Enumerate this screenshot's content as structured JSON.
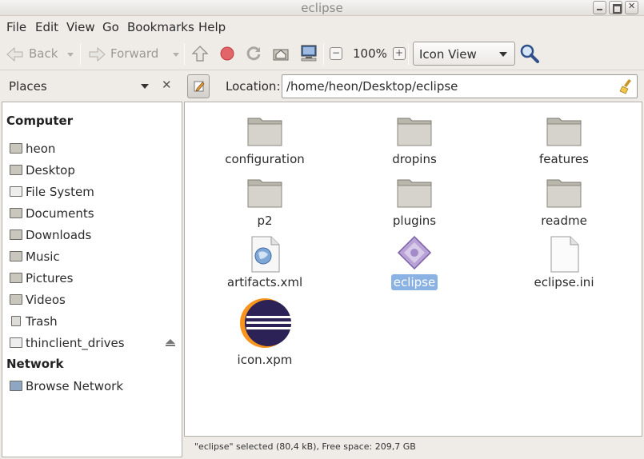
{
  "window": {
    "title": "eclipse"
  },
  "menu": [
    "File",
    "Edit",
    "View",
    "Go",
    "Bookmarks",
    "Help"
  ],
  "toolbar": {
    "back_label": "Back",
    "forward_label": "Forward",
    "zoom": "100%",
    "view_mode": "Icon View"
  },
  "sidebar": {
    "title": "Places",
    "sections": {
      "computer": "Computer",
      "network": "Network"
    },
    "places": [
      {
        "label": "heon",
        "icon": "home-folder-icon"
      },
      {
        "label": "Desktop",
        "icon": "desktop-folder-icon"
      },
      {
        "label": "File System",
        "icon": "filesystem-icon"
      },
      {
        "label": "Documents",
        "icon": "documents-folder-icon"
      },
      {
        "label": "Downloads",
        "icon": "downloads-folder-icon"
      },
      {
        "label": "Music",
        "icon": "music-folder-icon"
      },
      {
        "label": "Pictures",
        "icon": "pictures-folder-icon"
      },
      {
        "label": "Videos",
        "icon": "videos-folder-icon"
      },
      {
        "label": "Trash",
        "icon": "trash-icon"
      },
      {
        "label": "thinclient_drives",
        "icon": "drive-icon"
      }
    ],
    "network": [
      {
        "label": "Browse Network",
        "icon": "network-icon"
      }
    ]
  },
  "location": {
    "label": "Location:",
    "path": "/home/heon/Desktop/eclipse"
  },
  "files": [
    {
      "name": "configuration",
      "type": "folder"
    },
    {
      "name": "dropins",
      "type": "folder"
    },
    {
      "name": "features",
      "type": "folder"
    },
    {
      "name": "p2",
      "type": "folder"
    },
    {
      "name": "plugins",
      "type": "folder"
    },
    {
      "name": "readme",
      "type": "folder"
    },
    {
      "name": "artifacts.xml",
      "type": "xml"
    },
    {
      "name": "eclipse",
      "type": "executable",
      "selected": true
    },
    {
      "name": "eclipse.ini",
      "type": "text"
    },
    {
      "name": "icon.xpm",
      "type": "image"
    }
  ],
  "status": "\"eclipse\" selected (80,4 kB), Free space: 209,7 GB"
}
